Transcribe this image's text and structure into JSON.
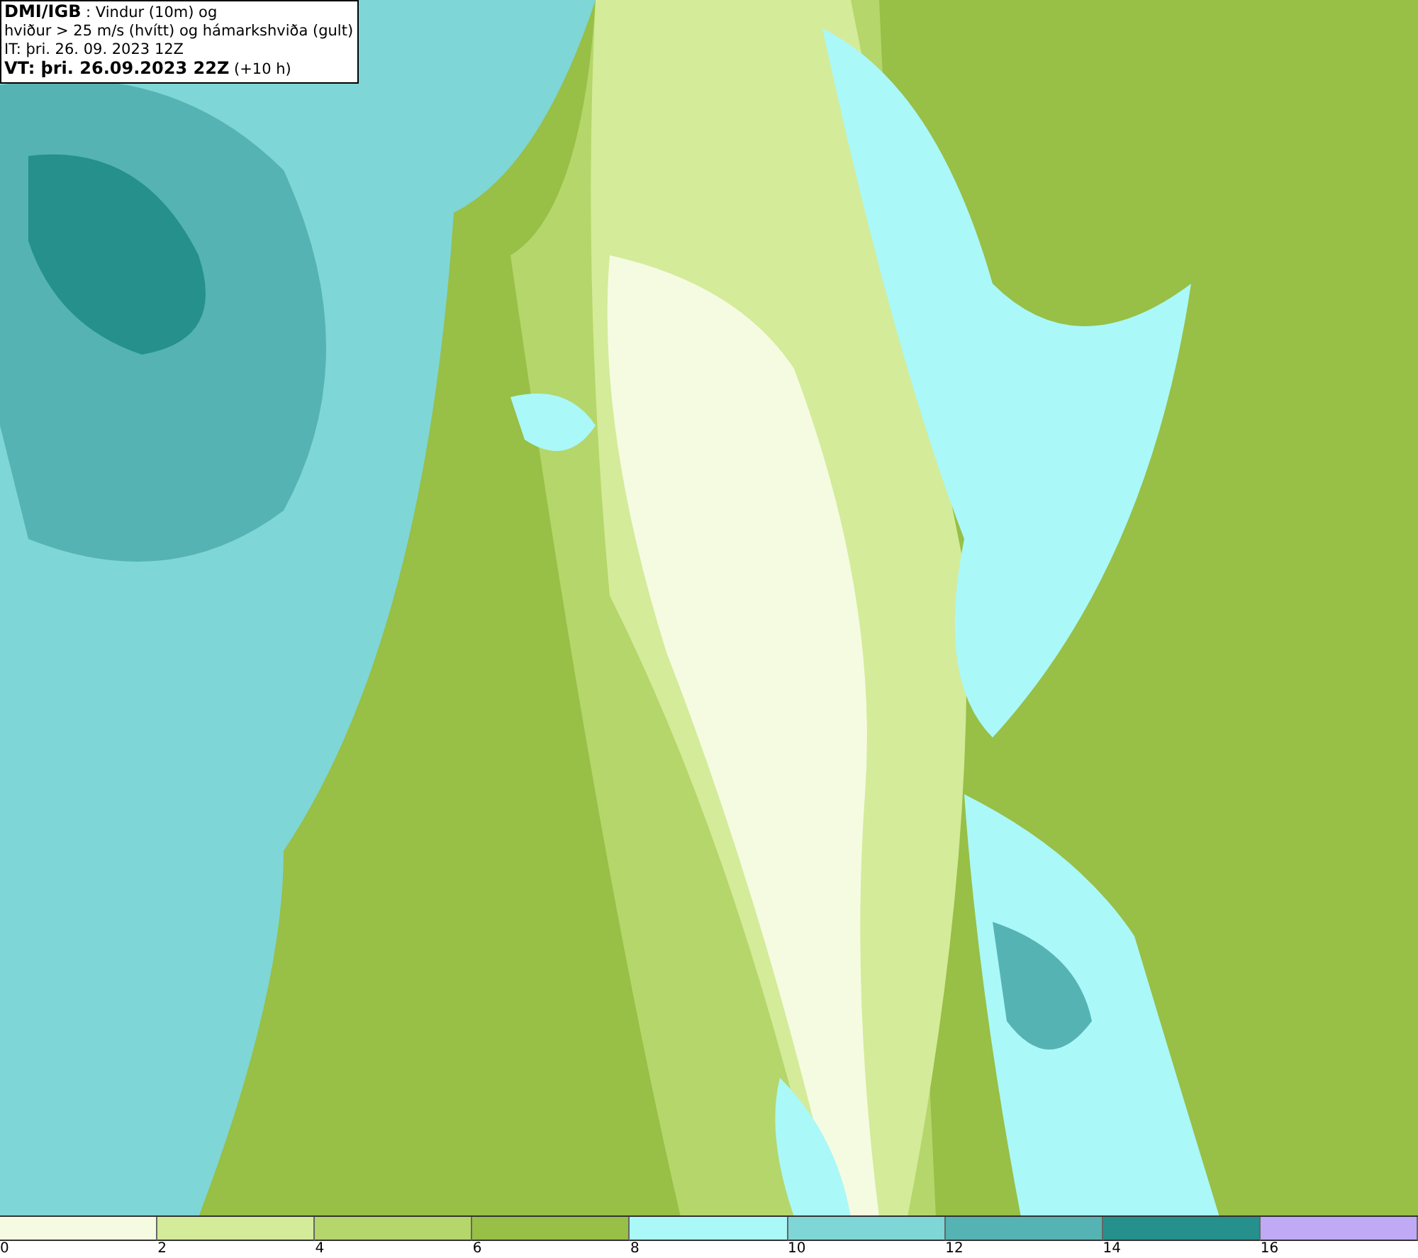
{
  "title_box": {
    "lines": [
      "**DMI/IGB** : Vindur (10m) og",
      "hviður > 25 m/s (hvítt) og hámarkshviða (gult)",
      "IT: þri. 26. 09. 2023 12Z",
      "**VT: þri. 26.09.2023 22Z** (+10 h)"
    ]
  },
  "legend": [
    {
      "label": "0",
      "color": "#f5fbe0"
    },
    {
      "label": "2",
      "color": "#d4eb9a"
    },
    {
      "label": "4",
      "color": "#b5d66a"
    },
    {
      "label": "6",
      "color": "#98bf46"
    },
    {
      "label": "8",
      "color": "#aaf8f8"
    },
    {
      "label": "10",
      "color": "#7fd6d6"
    },
    {
      "label": "12",
      "color": "#55b3b3"
    },
    {
      "label": "14",
      "color": "#25908c"
    },
    {
      "label": "16",
      "color": "#c0aaf5"
    }
  ]
}
